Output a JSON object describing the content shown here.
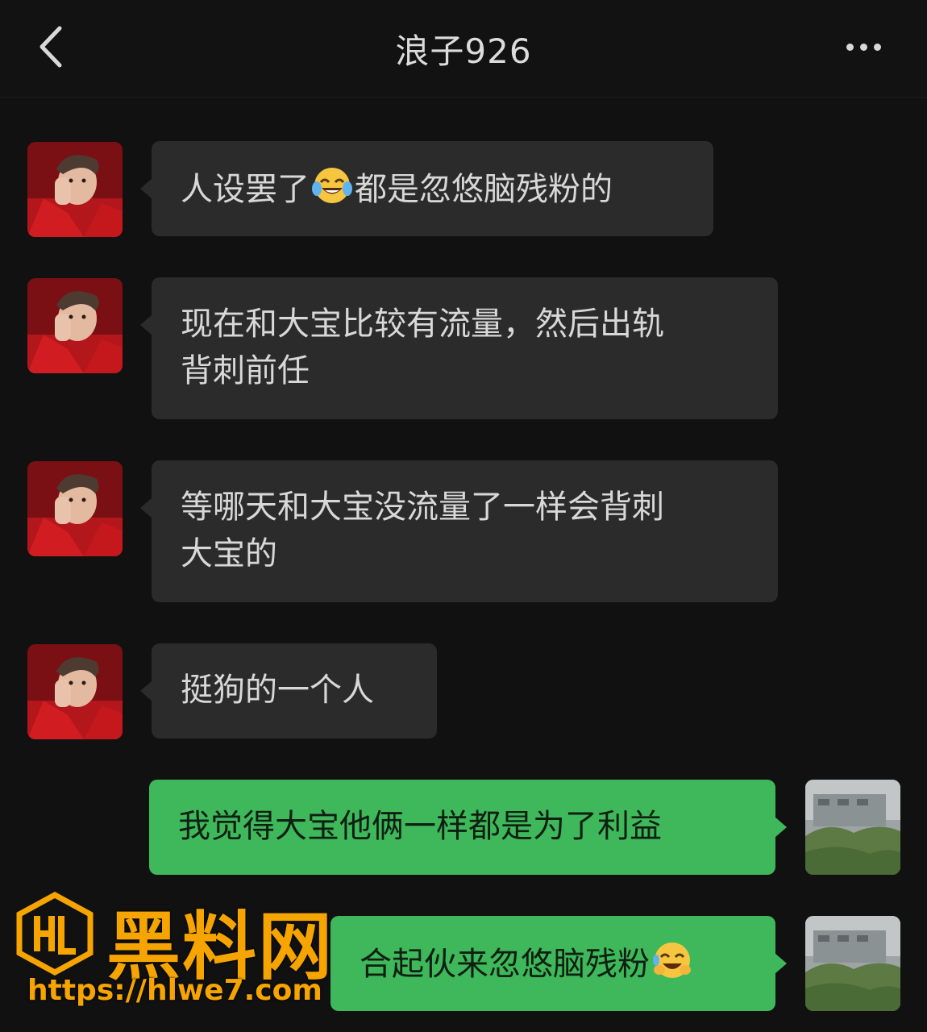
{
  "header": {
    "title": "浪子926",
    "back_icon": "chevron-left-icon",
    "more_icon": "more-dots-icon"
  },
  "messages": [
    {
      "side": "incoming",
      "text_before": "人设罢了",
      "emoji": "tears-of-joy",
      "text_after": "都是忽悠脑残粉的"
    },
    {
      "side": "incoming",
      "line1": "现在和大宝比较有流量，然后出轨",
      "line2": "背刺前任"
    },
    {
      "side": "incoming",
      "line1": "等哪天和大宝没流量了一样会背刺",
      "line2": "大宝的"
    },
    {
      "side": "incoming",
      "text": "挺狗的一个人"
    },
    {
      "side": "outgoing",
      "text": "我觉得大宝他俩一样都是为了利益"
    },
    {
      "side": "outgoing",
      "text": "合起伙来忽悠脑残粉",
      "emoji": "rolling-laughing"
    }
  ],
  "watermark": {
    "brand": "黑料网",
    "url": "https://hlwe7.com"
  },
  "colors": {
    "background": "#111111",
    "incoming_bubble": "#2b2b2b",
    "outgoing_bubble": "#3eb85a",
    "watermark": "#f6a500"
  }
}
